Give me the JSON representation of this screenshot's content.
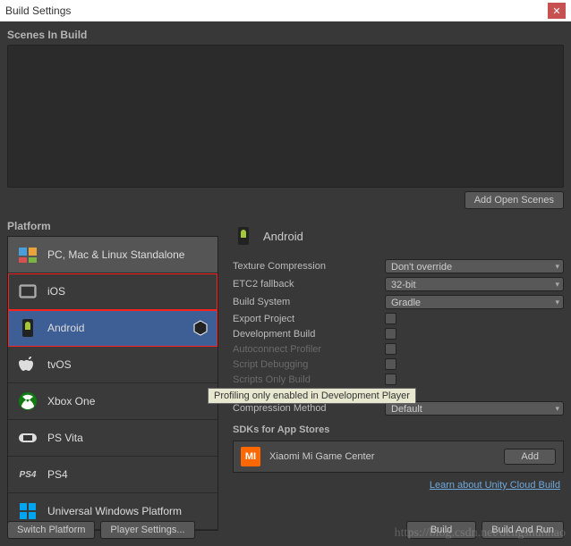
{
  "window": {
    "title": "Build Settings"
  },
  "scenes": {
    "label": "Scenes In Build",
    "add_button": "Add Open Scenes"
  },
  "platform": {
    "label": "Platform",
    "items": [
      {
        "label": "PC, Mac & Linux Standalone"
      },
      {
        "label": "iOS"
      },
      {
        "label": "Android"
      },
      {
        "label": "tvOS"
      },
      {
        "label": "Xbox One"
      },
      {
        "label": "PS Vita"
      },
      {
        "label": "PS4"
      },
      {
        "label": "Universal Windows Platform"
      }
    ]
  },
  "right": {
    "header": "Android",
    "settings": {
      "texture_compression": {
        "label": "Texture Compression",
        "value": "Don't override"
      },
      "etc2_fallback": {
        "label": "ETC2 fallback",
        "value": "32-bit"
      },
      "build_system": {
        "label": "Build System",
        "value": "Gradle"
      },
      "export_project": {
        "label": "Export Project"
      },
      "development_build": {
        "label": "Development Build"
      },
      "autoconnect_profiler": {
        "label": "Autoconnect Profiler"
      },
      "script_debugging": {
        "label": "Script Debugging"
      },
      "scripts_only_build": {
        "label": "Scripts Only Build"
      },
      "compression_method": {
        "label": "Compression Method",
        "value": "Default"
      }
    },
    "sdk": {
      "label": "SDKs for App Stores",
      "item": "Xiaomi Mi Game Center",
      "add": "Add"
    },
    "cloud_link": "Learn about Unity Cloud Build"
  },
  "tooltip": "Profiling only enabled in Development Player",
  "buttons": {
    "switch_platform": "Switch Platform",
    "player_settings": "Player Settings...",
    "build": "Build",
    "build_and_run": "Build And Run"
  },
  "watermark": "https://blog.csdn.net/dengshunhao"
}
